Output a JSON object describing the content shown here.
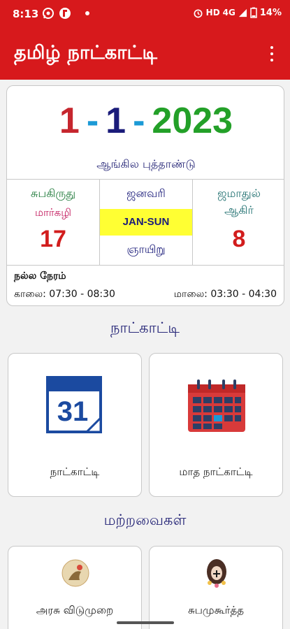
{
  "status": {
    "time": "8:13",
    "network": "HD",
    "signal": "4G",
    "battery": "14%"
  },
  "app": {
    "title": "தமிழ் நாட்காட்டி"
  },
  "today": {
    "day": "1",
    "separator": "-",
    "month": "1",
    "year": "2023",
    "event": "ஆங்கில புத்தாண்டு",
    "tamil_year": "சுபகிருது",
    "tamil_month": "மார்கழி",
    "tamil_date": "17",
    "english_month": "ஜனவரி",
    "short_code": "JAN-SUN",
    "weekday": "ஞாயிறு",
    "hijri_month_line1": "ஜமாதுல்",
    "hijri_month_line2": "ஆகிர்",
    "hijri_date": "8"
  },
  "good_time": {
    "title": "நல்ல நேரம்",
    "morning": "காலை: 07:30 - 08:30",
    "evening": "மாலை: 03:30 - 04:30"
  },
  "sections": {
    "calendar": "நாட்காட்டி",
    "others": "மற்றவைகள்"
  },
  "tiles": {
    "daily_calendar": {
      "label": "நாட்காட்டி",
      "icon": "calendar-31-icon",
      "number": "31"
    },
    "monthly_calendar": {
      "label": "மாத நாட்காட்டி",
      "icon": "month-calendar-icon"
    },
    "government_holidays": {
      "label": "அரசு விடுமுறை",
      "icon": "holiday-icon"
    },
    "auspicious_times": {
      "label": "சுபமுகூர்த்த",
      "icon": "wedding-icon"
    }
  },
  "colors": {
    "brand_red": "#d7191c",
    "date_red": "#c6262e",
    "date_blue": "#1b9ad6",
    "date_navy": "#1b1c7a",
    "date_green": "#23a028",
    "highlight_yellow": "#ffff33"
  }
}
